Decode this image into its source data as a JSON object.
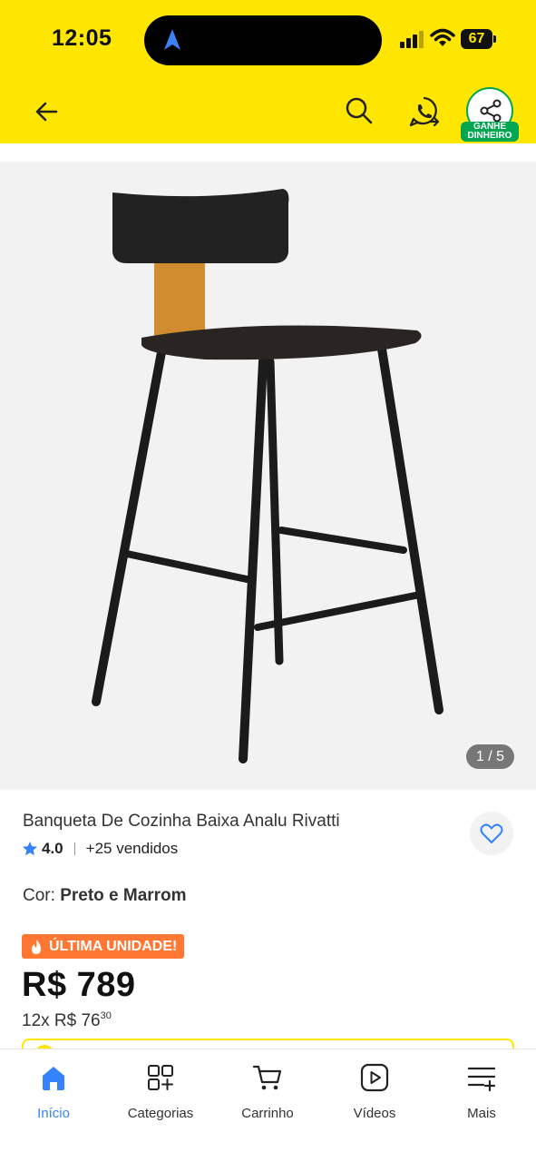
{
  "status_bar": {
    "time": "12:05",
    "battery": "67"
  },
  "header": {
    "share_label": "GANHE DINHEIRO"
  },
  "gallery": {
    "counter": "1 / 5"
  },
  "product": {
    "title": "Banqueta De Cozinha Baixa Analu Rivatti",
    "rating": "4.0",
    "sold": "+25 vendidos",
    "color_label": "Cor:",
    "color_value": "Preto e Marrom",
    "badge": "ÚLTIMA UNIDADE!",
    "price": "R$ 789",
    "installments_main": "12x R$ 76",
    "installments_cents": "30"
  },
  "nav": {
    "items": [
      {
        "label": "Início",
        "icon": "home-icon"
      },
      {
        "label": "Categorias",
        "icon": "categories-icon"
      },
      {
        "label": "Carrinho",
        "icon": "cart-icon"
      },
      {
        "label": "Vídeos",
        "icon": "video-icon"
      },
      {
        "label": "Mais",
        "icon": "more-icon"
      }
    ]
  },
  "colors": {
    "header_bg": "#ffe600",
    "accent": "#3483fa",
    "badge": "#ff7733",
    "share": "#00a650"
  }
}
